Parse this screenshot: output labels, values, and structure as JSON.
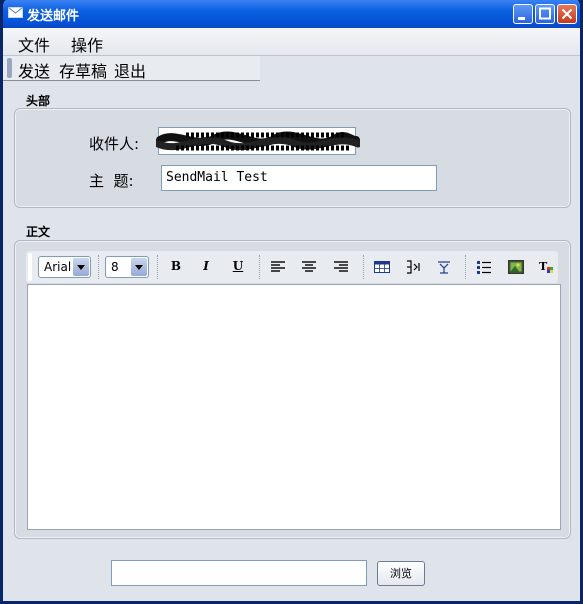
{
  "window": {
    "title": "发送邮件",
    "controls": [
      "minimize",
      "maximize",
      "close"
    ]
  },
  "menubar": {
    "items": [
      "文件",
      "操作"
    ]
  },
  "toolbar": {
    "items": [
      "发送",
      "存草稿",
      "退出"
    ]
  },
  "header_section": {
    "label": "头部",
    "recipient_label": "收件人:",
    "recipient_value_redacted": true,
    "subject_label": "主  题:",
    "subject_value": "SendMail Test"
  },
  "body_section": {
    "label": "正文",
    "font_family": "Arial",
    "font_size": "8",
    "format_tools": [
      "bold",
      "italic",
      "underline",
      "align-left",
      "align-center",
      "align-right",
      "insert-table",
      "table-tool-1",
      "table-tool-2",
      "bullet-list",
      "insert-image",
      "text-color"
    ],
    "bold_glyph": "B",
    "italic_glyph": "I",
    "underline_glyph": "U",
    "content": ""
  },
  "attachment": {
    "path_value": "",
    "browse_label": "浏览"
  },
  "colors": {
    "titlebar": "#0551d6",
    "window_bg": "#dfe3ea",
    "panel_bg": "#d7dbe2",
    "field_border": "#7f9db9"
  }
}
